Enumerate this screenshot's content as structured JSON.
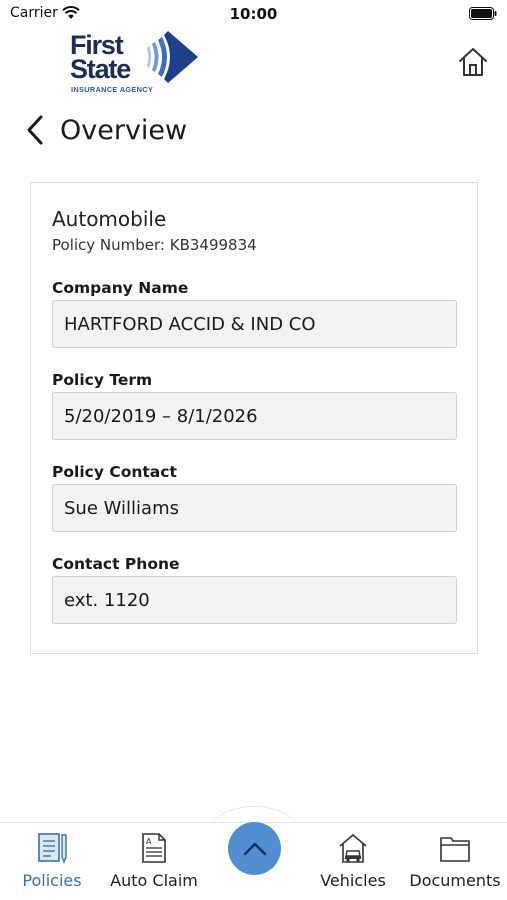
{
  "status_bar": {
    "carrier": "Carrier",
    "time": "10:00"
  },
  "header": {
    "logo": {
      "line1": "First",
      "line2": "State",
      "tagline": "INSURANCE AGENCY"
    },
    "back_title": "Overview"
  },
  "policy": {
    "type": "Automobile",
    "number_text": "Policy Number: KB3499834",
    "fields": [
      {
        "label": "Company Name",
        "value": "HARTFORD ACCID & IND CO"
      },
      {
        "label": "Policy Term",
        "value": "5/20/2019 – 8/1/2026"
      },
      {
        "label": "Policy Contact",
        "value": "Sue Williams"
      },
      {
        "label": "Contact Phone",
        "value": "ext. 1120"
      }
    ]
  },
  "bottom_nav": {
    "items": [
      {
        "label": "Policies",
        "icon": "policies-icon",
        "active": true
      },
      {
        "label": "Auto Claim",
        "icon": "auto-claim-icon",
        "active": false
      },
      {
        "label": "Vehicles",
        "icon": "vehicles-icon",
        "active": false
      },
      {
        "label": "Documents",
        "icon": "documents-icon",
        "active": false
      }
    ],
    "center_button_icon": "chevron-up-icon"
  },
  "colors": {
    "accent": "#4f8fd0",
    "active_nav": "#3a6fb0",
    "logo_navy": "#1a2c57",
    "logo_blue": "#2a5aa8",
    "field_bg": "#f2f2f2"
  }
}
